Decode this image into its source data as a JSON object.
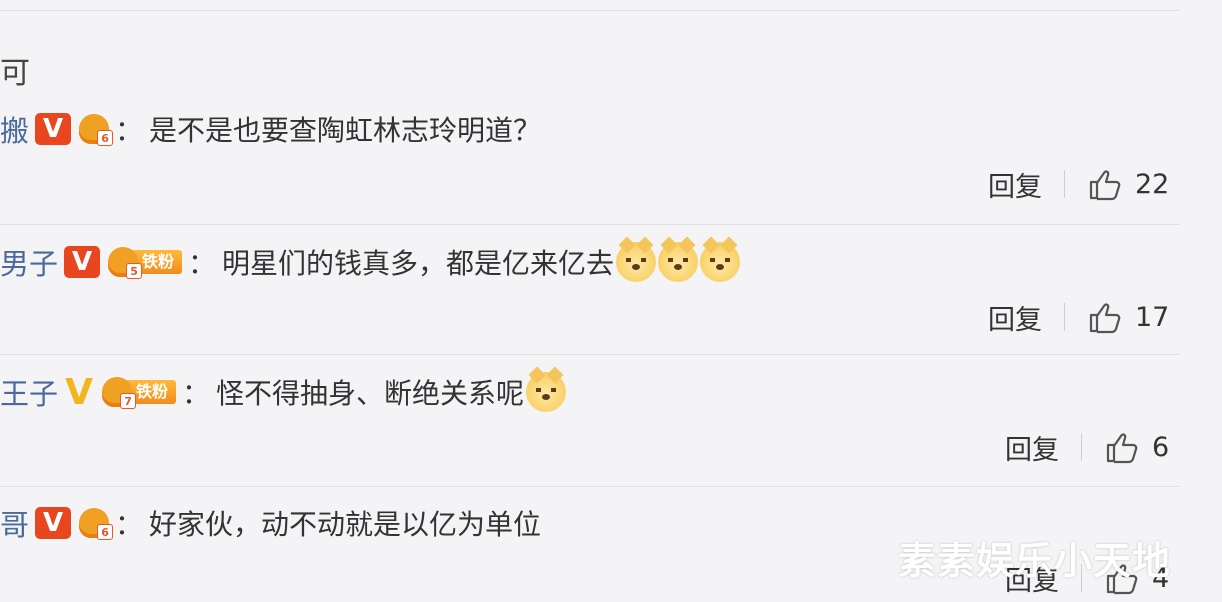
{
  "stray_char": "可",
  "comments": [
    {
      "user": "搬",
      "badge": "red",
      "fan_level": "6",
      "fan_tag": "",
      "text": "是不是也要查陶虹林志玲明道？",
      "emoji_count": 0,
      "reply": "回复",
      "likes": "22"
    },
    {
      "user": "男子",
      "badge": "red",
      "fan_level": "5",
      "fan_tag": "铁粉",
      "text": "明星们的钱真多，都是亿来亿去",
      "emoji_count": 3,
      "reply": "回复",
      "likes": "17"
    },
    {
      "user": "王子",
      "badge": "gold",
      "fan_level": "7",
      "fan_tag": "铁粉",
      "text": "怪不得抽身、断绝关系呢",
      "emoji_count": 1,
      "reply": "回复",
      "likes": "6"
    },
    {
      "user": "哥",
      "badge": "red",
      "fan_level": "6",
      "fan_tag": "",
      "text": "好家伙，动不动就是以亿为单位",
      "emoji_count": 0,
      "reply": "回复",
      "likes": "4"
    }
  ],
  "badge_v": "V",
  "colon": "：",
  "watermark": "素素娱乐小天地",
  "colors": {
    "background": "#f4f4f6",
    "username": "#4a6a9c",
    "vip_red": "#e8461e",
    "vip_gold": "#f2b51d"
  }
}
